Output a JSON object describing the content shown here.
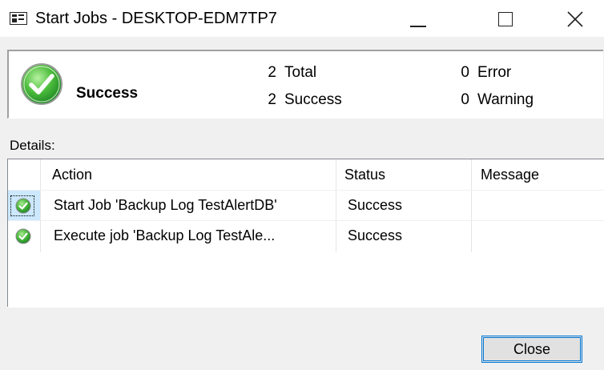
{
  "window": {
    "title": "Start Jobs - DESKTOP-EDM7TP7"
  },
  "summary": {
    "status": "Success",
    "total_count": "2",
    "total_label": "Total",
    "success_count": "2",
    "success_label": "Success",
    "error_count": "0",
    "error_label": "Error",
    "warning_count": "0",
    "warning_label": "Warning",
    "icon": "success-check-icon",
    "icon_color": "#3cab3c"
  },
  "details": {
    "label": "Details:",
    "columns": {
      "action": "Action",
      "status": "Status",
      "message": "Message"
    },
    "rows": [
      {
        "action": "Start Job 'Backup Log TestAlertDB'",
        "status": "Success",
        "message": ""
      },
      {
        "action": "Execute job 'Backup Log TestAle...",
        "status": "Success",
        "message": ""
      }
    ]
  },
  "buttons": {
    "close": "Close"
  },
  "colors": {
    "accent": "#0078d7",
    "selection": "#cce8ff",
    "success_green": "#3cab3c"
  }
}
